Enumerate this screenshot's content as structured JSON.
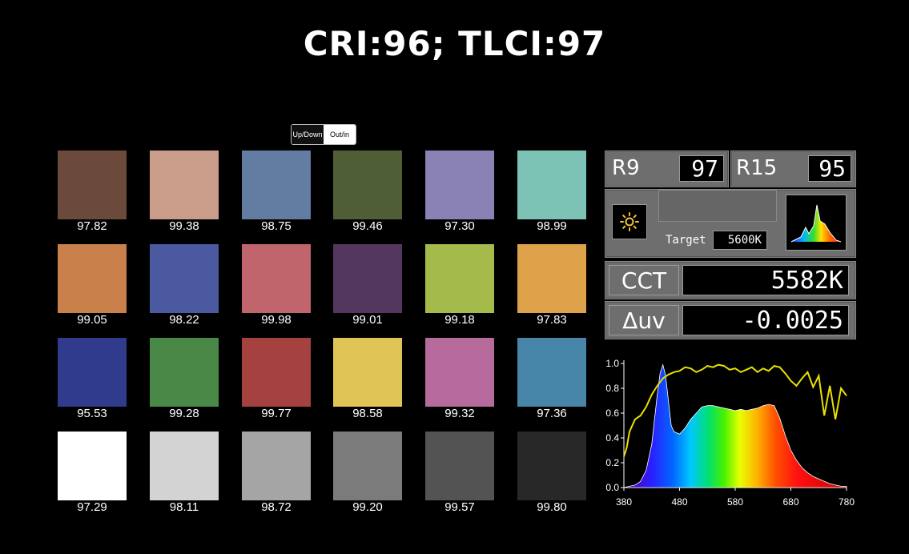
{
  "title": "CRI:96; TLCI:97",
  "toggle": {
    "option_a": "Up/Down",
    "option_b": "Out/in"
  },
  "swatches": [
    {
      "color": "#6b4a3b",
      "value": "97.82"
    },
    {
      "color": "#c99d89",
      "value": "99.38"
    },
    {
      "color": "#637ca1",
      "value": "98.75"
    },
    {
      "color": "#4f5e35",
      "value": "99.46"
    },
    {
      "color": "#8a81b5",
      "value": "97.30"
    },
    {
      "color": "#7cc3b6",
      "value": "98.99"
    },
    {
      "color": "#c9804a",
      "value": "99.05"
    },
    {
      "color": "#4a59a0",
      "value": "98.22"
    },
    {
      "color": "#c0656b",
      "value": "99.98"
    },
    {
      "color": "#54375f",
      "value": "99.01"
    },
    {
      "color": "#a4bb4c",
      "value": "99.18"
    },
    {
      "color": "#dea24a",
      "value": "97.83"
    },
    {
      "color": "#313b8b",
      "value": "95.53"
    },
    {
      "color": "#4a8848",
      "value": "99.28"
    },
    {
      "color": "#a5423f",
      "value": "99.77"
    },
    {
      "color": "#e1c456",
      "value": "98.58"
    },
    {
      "color": "#b76a9c",
      "value": "99.32"
    },
    {
      "color": "#4786a8",
      "value": "97.36"
    },
    {
      "color": "#ffffff",
      "value": "97.29"
    },
    {
      "color": "#d3d3d4",
      "value": "98.11"
    },
    {
      "color": "#a5a5a5",
      "value": "98.72"
    },
    {
      "color": "#7b7b7b",
      "value": "99.20"
    },
    {
      "color": "#535353",
      "value": "99.57"
    },
    {
      "color": "#282828",
      "value": "99.80"
    }
  ],
  "meter": {
    "r9_label": "R9",
    "r9_value": "97",
    "r15_label": "R15",
    "r15_value": "95",
    "light_icon": "sun-icon",
    "spectrum_icon": "spectrum-thumbnail-icon",
    "target_label": "Target",
    "target_value": "5600K",
    "cct_label": "CCT",
    "cct_value": "5582K",
    "duv_label": "Δuv",
    "duv_value": "-0.0025"
  },
  "chart_data": {
    "type": "area",
    "x_ticks": [
      "380",
      "480",
      "580",
      "680",
      "780"
    ],
    "y_ticks": [
      "0.0",
      "0.2",
      "0.4",
      "0.6",
      "0.8",
      "1.0"
    ],
    "xlim": [
      380,
      780
    ],
    "ylim": [
      0,
      1.0
    ],
    "grid": false,
    "series": [
      {
        "role": "spectral power distribution",
        "x": [
          380,
          390,
          400,
          410,
          420,
          430,
          440,
          445,
          450,
          455,
          460,
          465,
          470,
          480,
          490,
          500,
          510,
          520,
          530,
          540,
          550,
          560,
          570,
          580,
          590,
          600,
          610,
          620,
          630,
          640,
          650,
          660,
          670,
          680,
          690,
          700,
          710,
          720,
          730,
          740,
          750,
          760,
          770,
          780
        ],
        "y": [
          0.0,
          0.01,
          0.02,
          0.05,
          0.14,
          0.35,
          0.75,
          0.92,
          0.99,
          0.9,
          0.7,
          0.5,
          0.45,
          0.43,
          0.48,
          0.55,
          0.6,
          0.65,
          0.66,
          0.66,
          0.65,
          0.64,
          0.63,
          0.62,
          0.63,
          0.62,
          0.63,
          0.64,
          0.66,
          0.67,
          0.66,
          0.56,
          0.42,
          0.3,
          0.22,
          0.16,
          0.12,
          0.09,
          0.07,
          0.05,
          0.03,
          0.02,
          0.01,
          0.01
        ]
      },
      {
        "role": "fidelity curve",
        "x": [
          380,
          385,
          390,
          400,
          410,
          420,
          430,
          440,
          450,
          460,
          470,
          480,
          490,
          500,
          510,
          520,
          530,
          540,
          550,
          560,
          570,
          580,
          590,
          600,
          610,
          620,
          630,
          640,
          650,
          660,
          670,
          680,
          690,
          700,
          710,
          720,
          730,
          740,
          750,
          760,
          770,
          780
        ],
        "y": [
          0.25,
          0.32,
          0.45,
          0.55,
          0.58,
          0.65,
          0.75,
          0.82,
          0.88,
          0.91,
          0.93,
          0.94,
          0.97,
          0.96,
          0.93,
          0.95,
          0.98,
          0.97,
          0.99,
          0.98,
          0.95,
          0.96,
          0.93,
          0.95,
          0.97,
          0.93,
          0.96,
          0.94,
          0.98,
          0.97,
          0.92,
          0.86,
          0.82,
          0.88,
          0.93,
          0.81,
          0.9,
          0.58,
          0.82,
          0.55,
          0.8,
          0.74
        ]
      }
    ]
  }
}
